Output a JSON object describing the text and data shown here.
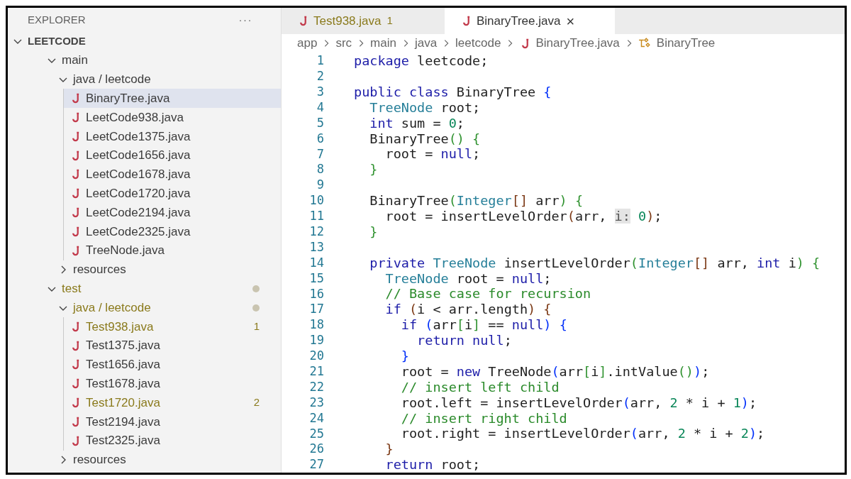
{
  "sidebar": {
    "title": "EXPLORER",
    "more": "···",
    "tree": [
      {
        "label": "LEETCODE",
        "kind": "root",
        "expanded": true,
        "children": [
          {
            "label": "main",
            "kind": "folder",
            "expanded": true,
            "children": [
              {
                "label": "java / leetcode",
                "kind": "folder",
                "expanded": true,
                "children": [
                  {
                    "label": "BinaryTree.java",
                    "kind": "file",
                    "selected": true
                  },
                  {
                    "label": "LeetCode938.java",
                    "kind": "file",
                    "selected": false
                  },
                  {
                    "label": "LeetCode1375.java",
                    "kind": "file",
                    "selected": false
                  },
                  {
                    "label": "LeetCode1656.java",
                    "kind": "file",
                    "selected": false
                  },
                  {
                    "label": "LeetCode1678.java",
                    "kind": "file",
                    "selected": false
                  },
                  {
                    "label": "LeetCode1720.java",
                    "kind": "file",
                    "selected": false
                  },
                  {
                    "label": "LeetCode2194.java",
                    "kind": "file",
                    "selected": false
                  },
                  {
                    "label": "LeetCode2325.java",
                    "kind": "file",
                    "selected": false
                  },
                  {
                    "label": "TreeNode.java",
                    "kind": "file",
                    "selected": false
                  }
                ]
              },
              {
                "label": "resources",
                "kind": "folder",
                "expanded": false
              }
            ]
          },
          {
            "label": "test",
            "kind": "folder",
            "expanded": true,
            "modified": true,
            "children": [
              {
                "label": "java / leetcode",
                "kind": "folder",
                "expanded": true,
                "modified": true,
                "children": [
                  {
                    "label": "Test938.java",
                    "kind": "file",
                    "selected": false,
                    "modified": true,
                    "badge": "1"
                  },
                  {
                    "label": "Test1375.java",
                    "kind": "file",
                    "selected": false
                  },
                  {
                    "label": "Test1656.java",
                    "kind": "file",
                    "selected": false
                  },
                  {
                    "label": "Test1678.java",
                    "kind": "file",
                    "selected": false
                  },
                  {
                    "label": "Test1720.java",
                    "kind": "file",
                    "selected": false,
                    "modified": true,
                    "badge": "2"
                  },
                  {
                    "label": "Test2194.java",
                    "kind": "file",
                    "selected": false
                  },
                  {
                    "label": "Test2325.java",
                    "kind": "file",
                    "selected": false
                  }
                ]
              },
              {
                "label": "resources",
                "kind": "folder",
                "expanded": false
              }
            ]
          }
        ]
      }
    ]
  },
  "tabs": [
    {
      "label": "Test938.java",
      "badge": "1",
      "modified": true,
      "selected": false
    },
    {
      "label": "BinaryTree.java",
      "close": "×",
      "selected": true
    }
  ],
  "breadcrumbs": [
    {
      "label": "app",
      "kind": "folder"
    },
    {
      "label": "src",
      "kind": "folder"
    },
    {
      "label": "main",
      "kind": "folder"
    },
    {
      "label": "java",
      "kind": "folder"
    },
    {
      "label": "leetcode",
      "kind": "folder"
    },
    {
      "label": "BinaryTree.java",
      "kind": "file"
    },
    {
      "label": "BinaryTree",
      "kind": "class"
    }
  ],
  "code": [
    {
      "number": "1",
      "tokens": [
        {
          "text": "package",
          "kind": "keyword"
        },
        {
          "text": " leetcode;",
          "kind": "plain"
        }
      ]
    },
    {
      "number": "2"
    },
    {
      "number": "3",
      "tokens": [
        {
          "text": "public class",
          "kind": "keyword"
        },
        {
          "text": " BinaryTree ",
          "kind": "plain"
        },
        {
          "text": "{",
          "kind": "bracket1"
        }
      ]
    },
    {
      "number": "4",
      "tokens": [
        {
          "text": "  TreeNode",
          "kind": "type"
        },
        {
          "text": " root;",
          "kind": "plain"
        }
      ]
    },
    {
      "number": "5",
      "tokens": [
        {
          "text": "  int",
          "kind": "keyword"
        },
        {
          "text": " sum = ",
          "kind": "plain"
        },
        {
          "text": "0",
          "kind": "number"
        },
        {
          "text": ";",
          "kind": "plain"
        }
      ]
    },
    {
      "number": "6",
      "tokens": [
        {
          "text": "  BinaryTree",
          "kind": "plain"
        },
        {
          "text": "() {",
          "kind": "bracket2"
        }
      ]
    },
    {
      "number": "7",
      "tokens": [
        {
          "text": "    root = ",
          "kind": "plain"
        },
        {
          "text": "null",
          "kind": "keyword"
        },
        {
          "text": ";",
          "kind": "plain"
        }
      ]
    },
    {
      "number": "8",
      "tokens": [
        {
          "text": "  }",
          "kind": "bracket2"
        }
      ]
    },
    {
      "number": "9"
    },
    {
      "number": "10",
      "tokens": [
        {
          "text": "  BinaryTree",
          "kind": "plain"
        },
        {
          "text": "(",
          "kind": "bracket2"
        },
        {
          "text": "Integer",
          "kind": "type"
        },
        {
          "text": "[]",
          "kind": "bracket3"
        },
        {
          "text": " arr",
          "kind": "plain"
        },
        {
          "text": ") {",
          "kind": "bracket2"
        }
      ]
    },
    {
      "number": "11",
      "tokens": [
        {
          "text": "    root = insertLevelOrder",
          "kind": "plain"
        },
        {
          "text": "(",
          "kind": "bracket3"
        },
        {
          "text": "arr, ",
          "kind": "plain"
        },
        {
          "text": "i:",
          "kind": "hint"
        },
        {
          "text": " 0",
          "kind": "number"
        },
        {
          "text": ")",
          "kind": "bracket3"
        },
        {
          "text": ";",
          "kind": "plain"
        }
      ]
    },
    {
      "number": "12",
      "tokens": [
        {
          "text": "  }",
          "kind": "bracket2"
        }
      ]
    },
    {
      "number": "13"
    },
    {
      "number": "14",
      "tokens": [
        {
          "text": "  private ",
          "kind": "keyword"
        },
        {
          "text": "TreeNode",
          "kind": "type"
        },
        {
          "text": " insertLevelOrder",
          "kind": "plain"
        },
        {
          "text": "(",
          "kind": "bracket2"
        },
        {
          "text": "Integer",
          "kind": "type"
        },
        {
          "text": "[]",
          "kind": "bracket3"
        },
        {
          "text": " arr, ",
          "kind": "plain"
        },
        {
          "text": "int",
          "kind": "keyword"
        },
        {
          "text": " i",
          "kind": "plain"
        },
        {
          "text": ") {",
          "kind": "bracket2"
        }
      ]
    },
    {
      "number": "15",
      "tokens": [
        {
          "text": "    TreeNode",
          "kind": "type"
        },
        {
          "text": " root = ",
          "kind": "plain"
        },
        {
          "text": "null",
          "kind": "keyword"
        },
        {
          "text": ";",
          "kind": "plain"
        }
      ]
    },
    {
      "number": "16",
      "tokens": [
        {
          "text": "    // Base case for recursion",
          "kind": "comment"
        }
      ]
    },
    {
      "number": "17",
      "tokens": [
        {
          "text": "    if ",
          "kind": "keyword"
        },
        {
          "text": "(",
          "kind": "bracket3"
        },
        {
          "text": "i < arr.length",
          "kind": "plain"
        },
        {
          "text": ") {",
          "kind": "bracket3"
        }
      ]
    },
    {
      "number": "18",
      "tokens": [
        {
          "text": "      if ",
          "kind": "keyword"
        },
        {
          "text": "(",
          "kind": "bracket1"
        },
        {
          "text": "arr",
          "kind": "plain"
        },
        {
          "text": "[",
          "kind": "bracket2"
        },
        {
          "text": "i",
          "kind": "plain"
        },
        {
          "text": "]",
          "kind": "bracket2"
        },
        {
          "text": " == ",
          "kind": "plain"
        },
        {
          "text": "null",
          "kind": "keyword"
        },
        {
          "text": ") {",
          "kind": "bracket1"
        }
      ]
    },
    {
      "number": "19",
      "tokens": [
        {
          "text": "        return null",
          "kind": "keyword"
        },
        {
          "text": ";",
          "kind": "plain"
        }
      ]
    },
    {
      "number": "20",
      "tokens": [
        {
          "text": "      }",
          "kind": "bracket1"
        }
      ]
    },
    {
      "number": "21",
      "tokens": [
        {
          "text": "      root = ",
          "kind": "plain"
        },
        {
          "text": "new",
          "kind": "keyword"
        },
        {
          "text": " TreeNode",
          "kind": "plain"
        },
        {
          "text": "(",
          "kind": "bracket1"
        },
        {
          "text": "arr",
          "kind": "plain"
        },
        {
          "text": "[",
          "kind": "bracket2"
        },
        {
          "text": "i",
          "kind": "plain"
        },
        {
          "text": "]",
          "kind": "bracket2"
        },
        {
          "text": ".intValue",
          "kind": "plain"
        },
        {
          "text": "()",
          "kind": "bracket2"
        },
        {
          "text": ")",
          "kind": "bracket1"
        },
        {
          "text": ";",
          "kind": "plain"
        }
      ]
    },
    {
      "number": "22",
      "tokens": [
        {
          "text": "      // insert left child",
          "kind": "comment"
        }
      ]
    },
    {
      "number": "23",
      "tokens": [
        {
          "text": "      root.left = insertLevelOrder",
          "kind": "plain"
        },
        {
          "text": "(",
          "kind": "bracket1"
        },
        {
          "text": "arr, ",
          "kind": "plain"
        },
        {
          "text": "2",
          "kind": "number"
        },
        {
          "text": " * i + ",
          "kind": "plain"
        },
        {
          "text": "1",
          "kind": "number"
        },
        {
          "text": ")",
          "kind": "bracket1"
        },
        {
          "text": ";",
          "kind": "plain"
        }
      ]
    },
    {
      "number": "24",
      "tokens": [
        {
          "text": "      // insert right child",
          "kind": "comment"
        }
      ]
    },
    {
      "number": "25",
      "tokens": [
        {
          "text": "      root.right = insertLevelOrder",
          "kind": "plain"
        },
        {
          "text": "(",
          "kind": "bracket1"
        },
        {
          "text": "arr, ",
          "kind": "plain"
        },
        {
          "text": "2",
          "kind": "number"
        },
        {
          "text": " * i + ",
          "kind": "plain"
        },
        {
          "text": "2",
          "kind": "number"
        },
        {
          "text": ")",
          "kind": "bracket1"
        },
        {
          "text": ";",
          "kind": "plain"
        }
      ]
    },
    {
      "number": "26",
      "tokens": [
        {
          "text": "    }",
          "kind": "bracket3"
        }
      ]
    },
    {
      "number": "27",
      "tokens": [
        {
          "text": "    return",
          "kind": "keyword"
        },
        {
          "text": " root;",
          "kind": "plain"
        }
      ]
    }
  ]
}
